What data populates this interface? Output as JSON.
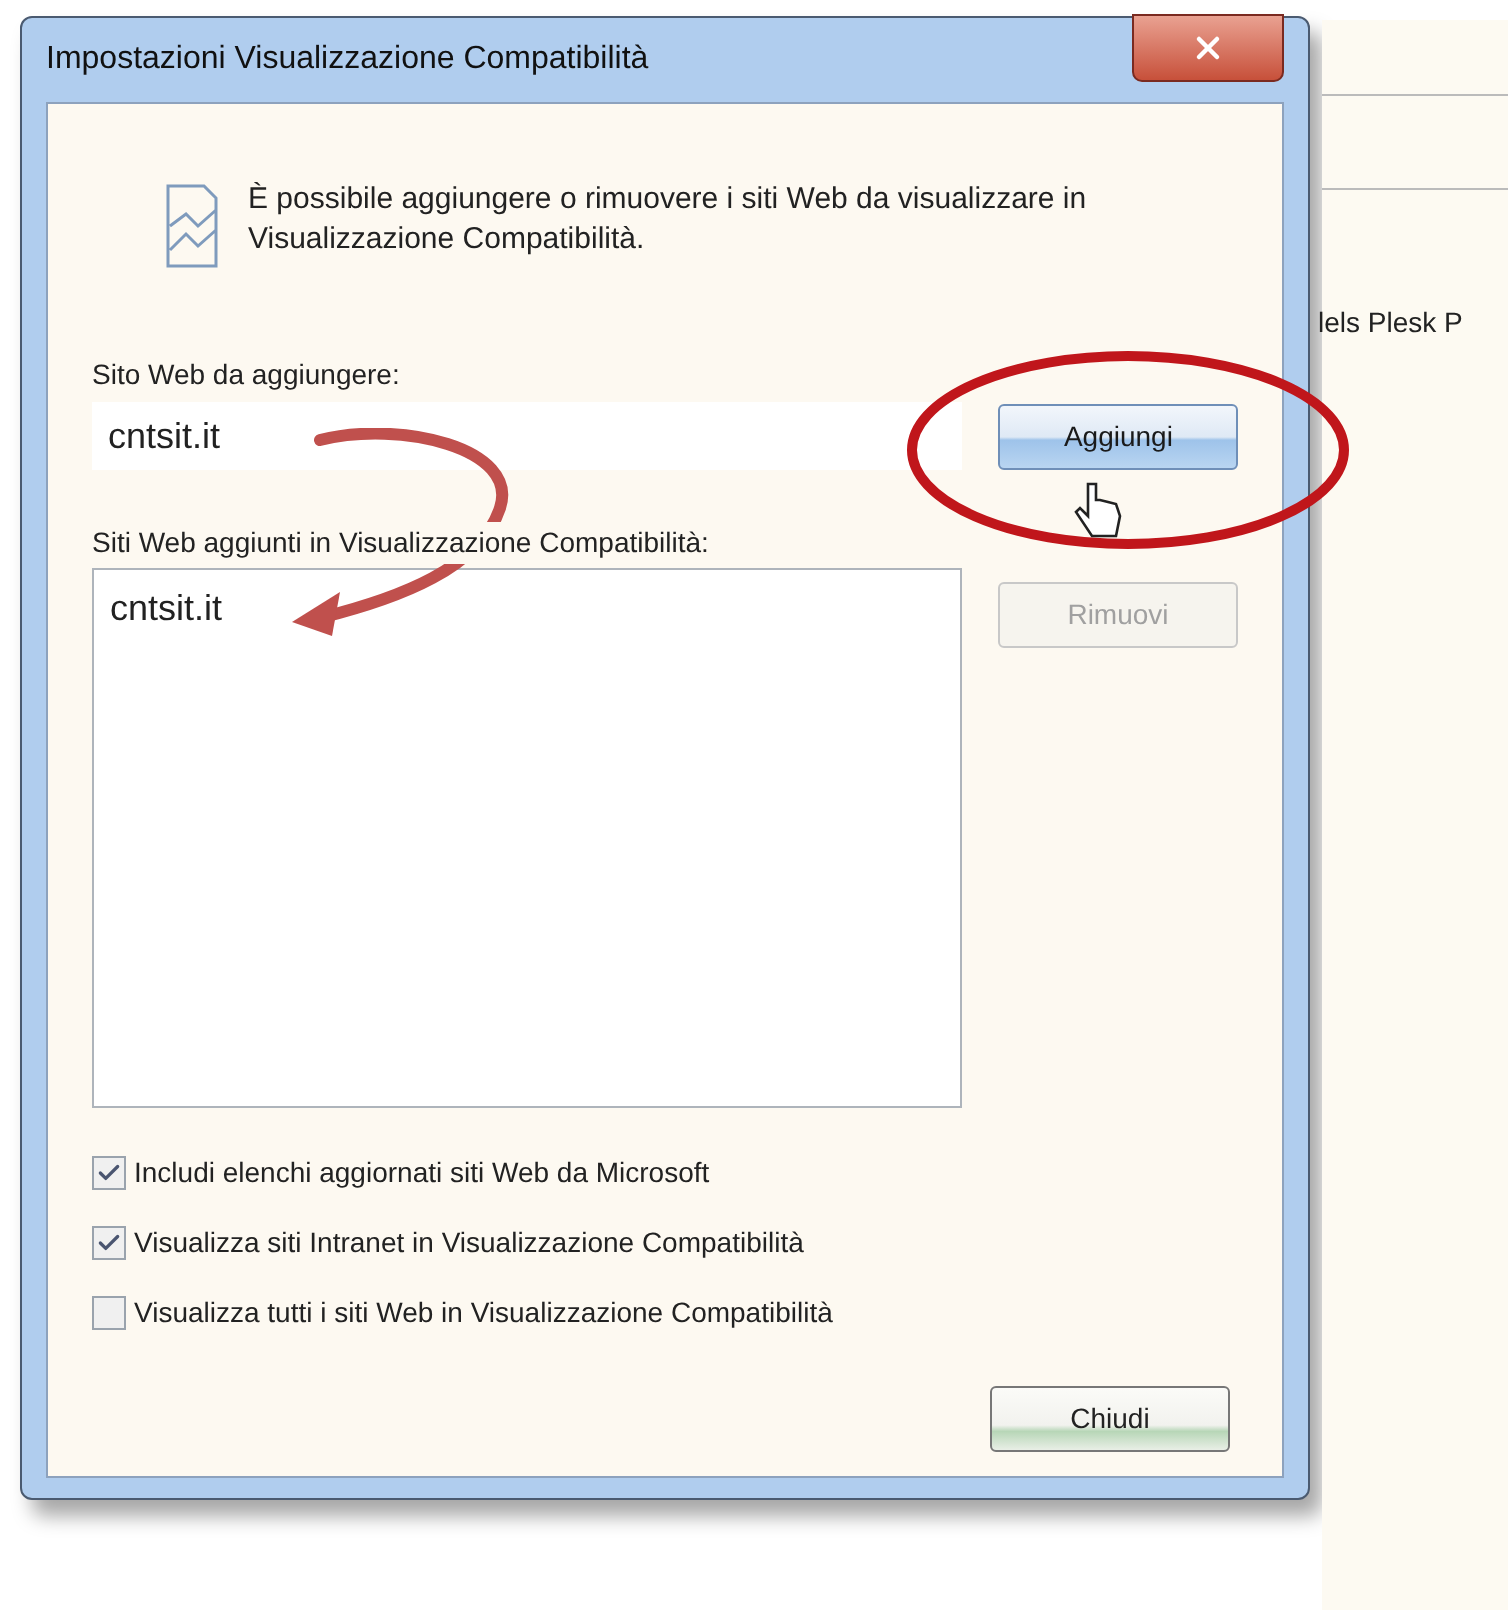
{
  "window": {
    "title": "Impostazioni Visualizzazione Compatibilità"
  },
  "description": "È possibile aggiungere o rimuovere i siti Web da visualizzare in Visualizzazione Compatibilità.",
  "add_field": {
    "label": "Sito Web da aggiungere:",
    "value": "cntsit.it"
  },
  "add_button": {
    "label": "Aggiungi",
    "disabled": false
  },
  "list": {
    "label": "Siti Web aggiunti in Visualizzazione Compatibilità:",
    "items": [
      {
        "text": "cntsit.it",
        "selected": false
      }
    ]
  },
  "remove_button": {
    "label": "Rimuovi",
    "disabled": true
  },
  "options": [
    {
      "label": "Includi elenchi aggiornati siti Web da Microsoft",
      "checked": true
    },
    {
      "label": "Visualizza siti Intranet in Visualizzazione Compatibilità",
      "checked": true
    },
    {
      "label": "Visualizza tutti i siti Web in Visualizzazione Compatibilità",
      "checked": false
    }
  ],
  "close_button": {
    "label": "Chiudi"
  },
  "background": {
    "text": "lels Plesk P"
  }
}
